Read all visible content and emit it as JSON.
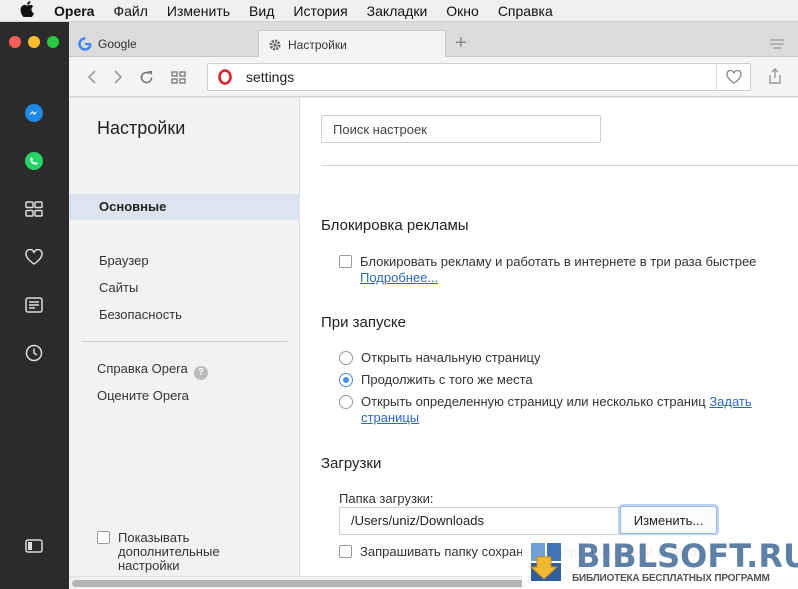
{
  "menubar": {
    "app": "Opera",
    "items": [
      "Файл",
      "Изменить",
      "Вид",
      "История",
      "Закладки",
      "Окно",
      "Справка"
    ]
  },
  "tabs": [
    {
      "label": "Google",
      "icon": "google-icon"
    },
    {
      "label": "Настройки",
      "icon": "gear-icon"
    }
  ],
  "address": {
    "url": "settings"
  },
  "sidebar_icons": [
    "messenger-icon",
    "whatsapp-icon",
    "speed-dial-icon",
    "heart-icon",
    "news-icon",
    "history-icon",
    "sidebar-toggle-icon"
  ],
  "settings_nav": {
    "title": "Настройки",
    "active": "Основные",
    "items": [
      "Браузер",
      "Сайты",
      "Безопасность"
    ],
    "help": "Справка Opera",
    "rate": "Оцените Opera",
    "advanced": "Показывать дополнительные настройки"
  },
  "search": {
    "placeholder": "Поиск настроек"
  },
  "adblock": {
    "title": "Блокировка рекламы",
    "option": "Блокировать рекламу и работать в интернете в три раза быстрее",
    "more": "Подробнее...",
    "checked": false
  },
  "startup": {
    "title": "При запуске",
    "options": [
      "Открыть начальную страницу",
      "Продолжить с того же места",
      "Открыть определенную страницу или несколько страниц"
    ],
    "link": "Задать страницы",
    "selected_index": 1
  },
  "downloads": {
    "title": "Загрузки",
    "folder_label": "Папка загрузки:",
    "path": "/Users/uniz/Downloads",
    "change": "Изменить...",
    "ask": "Запрашивать папку сохранения перед загрузкой файла"
  },
  "watermark": {
    "brand": "BIBLSOFT.RU",
    "sub": "БИБЛИОТЕКА БЕСПЛАТНЫХ ПРОГРАММ"
  }
}
